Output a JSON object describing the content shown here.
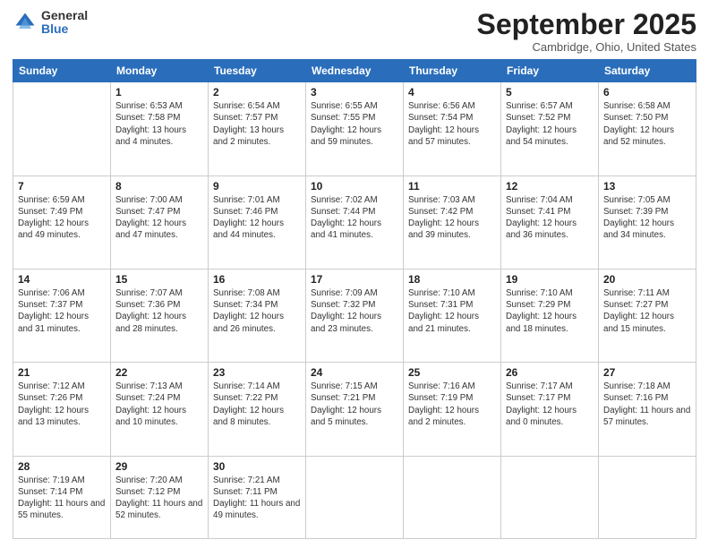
{
  "logo": {
    "general": "General",
    "blue": "Blue"
  },
  "header": {
    "month": "September 2025",
    "location": "Cambridge, Ohio, United States"
  },
  "weekdays": [
    "Sunday",
    "Monday",
    "Tuesday",
    "Wednesday",
    "Thursday",
    "Friday",
    "Saturday"
  ],
  "weeks": [
    [
      {
        "day": "",
        "sunrise": "",
        "sunset": "",
        "daylight": ""
      },
      {
        "day": "1",
        "sunrise": "Sunrise: 6:53 AM",
        "sunset": "Sunset: 7:58 PM",
        "daylight": "Daylight: 13 hours and 4 minutes."
      },
      {
        "day": "2",
        "sunrise": "Sunrise: 6:54 AM",
        "sunset": "Sunset: 7:57 PM",
        "daylight": "Daylight: 13 hours and 2 minutes."
      },
      {
        "day": "3",
        "sunrise": "Sunrise: 6:55 AM",
        "sunset": "Sunset: 7:55 PM",
        "daylight": "Daylight: 12 hours and 59 minutes."
      },
      {
        "day": "4",
        "sunrise": "Sunrise: 6:56 AM",
        "sunset": "Sunset: 7:54 PM",
        "daylight": "Daylight: 12 hours and 57 minutes."
      },
      {
        "day": "5",
        "sunrise": "Sunrise: 6:57 AM",
        "sunset": "Sunset: 7:52 PM",
        "daylight": "Daylight: 12 hours and 54 minutes."
      },
      {
        "day": "6",
        "sunrise": "Sunrise: 6:58 AM",
        "sunset": "Sunset: 7:50 PM",
        "daylight": "Daylight: 12 hours and 52 minutes."
      }
    ],
    [
      {
        "day": "7",
        "sunrise": "Sunrise: 6:59 AM",
        "sunset": "Sunset: 7:49 PM",
        "daylight": "Daylight: 12 hours and 49 minutes."
      },
      {
        "day": "8",
        "sunrise": "Sunrise: 7:00 AM",
        "sunset": "Sunset: 7:47 PM",
        "daylight": "Daylight: 12 hours and 47 minutes."
      },
      {
        "day": "9",
        "sunrise": "Sunrise: 7:01 AM",
        "sunset": "Sunset: 7:46 PM",
        "daylight": "Daylight: 12 hours and 44 minutes."
      },
      {
        "day": "10",
        "sunrise": "Sunrise: 7:02 AM",
        "sunset": "Sunset: 7:44 PM",
        "daylight": "Daylight: 12 hours and 41 minutes."
      },
      {
        "day": "11",
        "sunrise": "Sunrise: 7:03 AM",
        "sunset": "Sunset: 7:42 PM",
        "daylight": "Daylight: 12 hours and 39 minutes."
      },
      {
        "day": "12",
        "sunrise": "Sunrise: 7:04 AM",
        "sunset": "Sunset: 7:41 PM",
        "daylight": "Daylight: 12 hours and 36 minutes."
      },
      {
        "day": "13",
        "sunrise": "Sunrise: 7:05 AM",
        "sunset": "Sunset: 7:39 PM",
        "daylight": "Daylight: 12 hours and 34 minutes."
      }
    ],
    [
      {
        "day": "14",
        "sunrise": "Sunrise: 7:06 AM",
        "sunset": "Sunset: 7:37 PM",
        "daylight": "Daylight: 12 hours and 31 minutes."
      },
      {
        "day": "15",
        "sunrise": "Sunrise: 7:07 AM",
        "sunset": "Sunset: 7:36 PM",
        "daylight": "Daylight: 12 hours and 28 minutes."
      },
      {
        "day": "16",
        "sunrise": "Sunrise: 7:08 AM",
        "sunset": "Sunset: 7:34 PM",
        "daylight": "Daylight: 12 hours and 26 minutes."
      },
      {
        "day": "17",
        "sunrise": "Sunrise: 7:09 AM",
        "sunset": "Sunset: 7:32 PM",
        "daylight": "Daylight: 12 hours and 23 minutes."
      },
      {
        "day": "18",
        "sunrise": "Sunrise: 7:10 AM",
        "sunset": "Sunset: 7:31 PM",
        "daylight": "Daylight: 12 hours and 21 minutes."
      },
      {
        "day": "19",
        "sunrise": "Sunrise: 7:10 AM",
        "sunset": "Sunset: 7:29 PM",
        "daylight": "Daylight: 12 hours and 18 minutes."
      },
      {
        "day": "20",
        "sunrise": "Sunrise: 7:11 AM",
        "sunset": "Sunset: 7:27 PM",
        "daylight": "Daylight: 12 hours and 15 minutes."
      }
    ],
    [
      {
        "day": "21",
        "sunrise": "Sunrise: 7:12 AM",
        "sunset": "Sunset: 7:26 PM",
        "daylight": "Daylight: 12 hours and 13 minutes."
      },
      {
        "day": "22",
        "sunrise": "Sunrise: 7:13 AM",
        "sunset": "Sunset: 7:24 PM",
        "daylight": "Daylight: 12 hours and 10 minutes."
      },
      {
        "day": "23",
        "sunrise": "Sunrise: 7:14 AM",
        "sunset": "Sunset: 7:22 PM",
        "daylight": "Daylight: 12 hours and 8 minutes."
      },
      {
        "day": "24",
        "sunrise": "Sunrise: 7:15 AM",
        "sunset": "Sunset: 7:21 PM",
        "daylight": "Daylight: 12 hours and 5 minutes."
      },
      {
        "day": "25",
        "sunrise": "Sunrise: 7:16 AM",
        "sunset": "Sunset: 7:19 PM",
        "daylight": "Daylight: 12 hours and 2 minutes."
      },
      {
        "day": "26",
        "sunrise": "Sunrise: 7:17 AM",
        "sunset": "Sunset: 7:17 PM",
        "daylight": "Daylight: 12 hours and 0 minutes."
      },
      {
        "day": "27",
        "sunrise": "Sunrise: 7:18 AM",
        "sunset": "Sunset: 7:16 PM",
        "daylight": "Daylight: 11 hours and 57 minutes."
      }
    ],
    [
      {
        "day": "28",
        "sunrise": "Sunrise: 7:19 AM",
        "sunset": "Sunset: 7:14 PM",
        "daylight": "Daylight: 11 hours and 55 minutes."
      },
      {
        "day": "29",
        "sunrise": "Sunrise: 7:20 AM",
        "sunset": "Sunset: 7:12 PM",
        "daylight": "Daylight: 11 hours and 52 minutes."
      },
      {
        "day": "30",
        "sunrise": "Sunrise: 7:21 AM",
        "sunset": "Sunset: 7:11 PM",
        "daylight": "Daylight: 11 hours and 49 minutes."
      },
      {
        "day": "",
        "sunrise": "",
        "sunset": "",
        "daylight": ""
      },
      {
        "day": "",
        "sunrise": "",
        "sunset": "",
        "daylight": ""
      },
      {
        "day": "",
        "sunrise": "",
        "sunset": "",
        "daylight": ""
      },
      {
        "day": "",
        "sunrise": "",
        "sunset": "",
        "daylight": ""
      }
    ]
  ]
}
